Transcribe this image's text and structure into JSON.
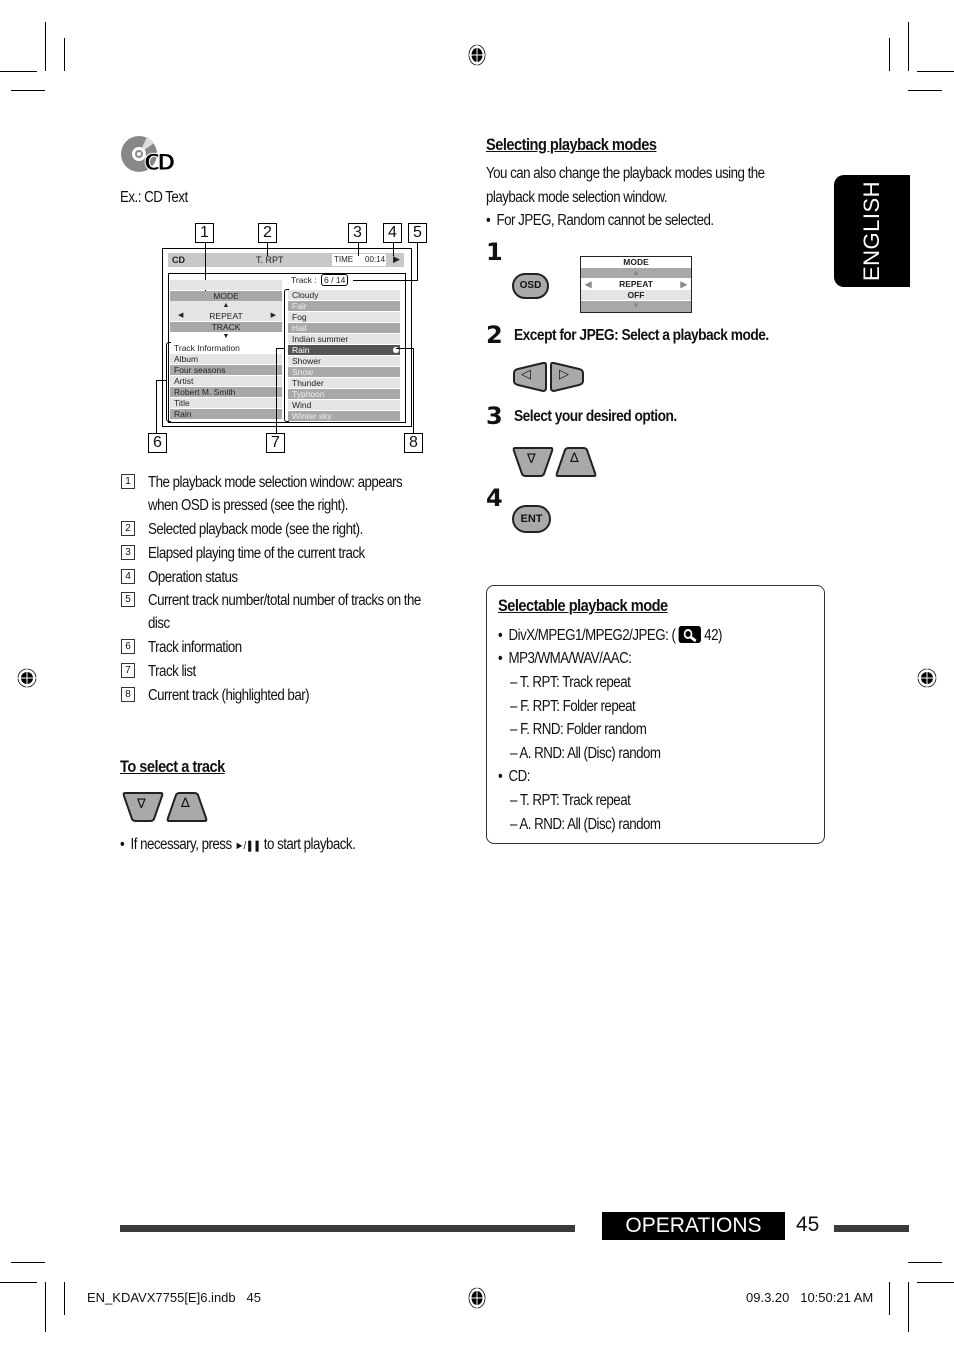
{
  "page": {
    "language_tab": "ENGLISH",
    "section": "OPERATIONS",
    "page_number": "45",
    "footer_file": "EN_KDAVX7755[E]6.indb   45",
    "footer_timestamp": "09.3.20   10:50:21 AM"
  },
  "left": {
    "cd_logo": "CD",
    "example_caption": "Ex.: CD Text",
    "diagram": {
      "callouts": [
        "1",
        "2",
        "3",
        "4",
        "5",
        "6",
        "7",
        "8"
      ],
      "source": "CD",
      "mode_indicator": "T. RPT",
      "time_label": "TIME",
      "time_value": "00:14",
      "status_icon": "play-icon",
      "track_label": "Track :",
      "track_counter": "6 / 14",
      "mode_window": {
        "title": "MODE",
        "item": "REPEAT",
        "value": "TRACK"
      },
      "track_info_title": "Track Information",
      "track_info": [
        "Album",
        "Four seasons",
        "Artist",
        "Robert M. Smith",
        "Title",
        "Rain"
      ],
      "track_list": [
        "Cloudy",
        "Fair",
        "Fog",
        "Hail",
        "Indian summer",
        "Rain",
        "Shower",
        "Snow",
        "Thunder",
        "Typhoon",
        "Wind",
        "Winter sky"
      ],
      "current_track_index": 5
    },
    "legend": [
      {
        "num": "1",
        "lines": [
          "The playback mode selection window: appears",
          "when OSD is pressed (see the right)."
        ]
      },
      {
        "num": "2",
        "lines": [
          "Selected playback mode (see the right)."
        ]
      },
      {
        "num": "3",
        "lines": [
          "Elapsed playing time of the current track"
        ]
      },
      {
        "num": "4",
        "lines": [
          "Operation status"
        ]
      },
      {
        "num": "5",
        "lines": [
          "Current track number/total number of tracks on the",
          "disc"
        ]
      },
      {
        "num": "6",
        "lines": [
          "Track information"
        ]
      },
      {
        "num": "7",
        "lines": [
          "Track list"
        ]
      },
      {
        "num": "8",
        "lines": [
          "Current track (highlighted bar)"
        ]
      }
    ],
    "select_track": {
      "heading": "To select a track",
      "down_glyph": "∇",
      "up_glyph": "∆",
      "note_prefix": "If necessary, press",
      "note_symbol": "►/❚❚",
      "note_suffix": "to start playback."
    }
  },
  "right": {
    "heading": "Selecting playback modes",
    "intro_lines": [
      "You can also change the playback modes using the",
      "playback mode selection window."
    ],
    "intro_bullet": "For JPEG, Random cannot be selected.",
    "steps": [
      {
        "num": "1",
        "text": "",
        "button": "OSD"
      },
      {
        "num": "2",
        "text": "Except for JPEG: Select a playback mode."
      },
      {
        "num": "3",
        "text": "Select your desired option."
      },
      {
        "num": "4",
        "text": "",
        "button": "ENT"
      }
    ],
    "mode_window": {
      "title": "MODE",
      "item": "REPEAT",
      "value": "OFF"
    },
    "left_glyph": "◁",
    "right_glyph": "▷",
    "down_glyph": "∇",
    "up_glyph": "∆",
    "selectable": {
      "heading": "Selectable playback mode",
      "divx_prefix": "DivX/MPEG1/MPEG2/JPEG: (",
      "divx_ref": "42)",
      "mp3_label": "MP3/WMA/WAV/AAC:",
      "mp3_modes": [
        "– T. RPT: Track repeat",
        "– F. RPT: Folder repeat",
        "– F. RND: Folder random",
        "– A. RND: All (Disc) random"
      ],
      "cd_label": "CD:",
      "cd_modes": [
        "– T. RPT: Track repeat",
        "– A. RND: All (Disc) random"
      ]
    }
  },
  "colors": {
    "tab_bg": "#000000",
    "bar_gray": "#3a3a3a",
    "button_gray": "#a9a9a9",
    "highlight": "#555555"
  }
}
